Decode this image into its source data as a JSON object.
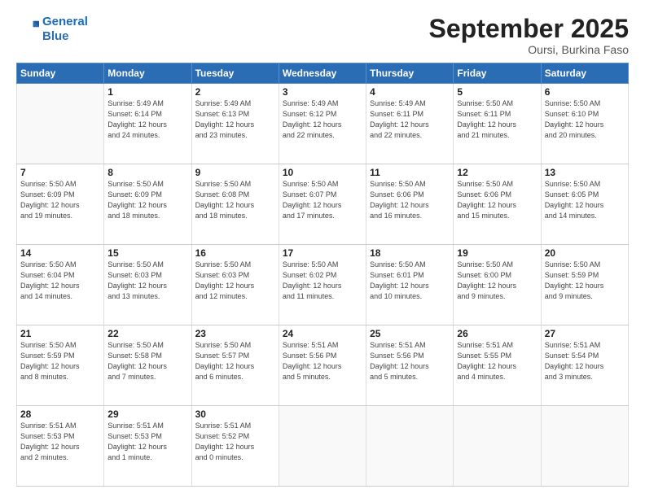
{
  "logo": {
    "line1": "General",
    "line2": "Blue"
  },
  "title": {
    "month": "September 2025",
    "location": "Oursi, Burkina Faso"
  },
  "weekdays": [
    "Sunday",
    "Monday",
    "Tuesday",
    "Wednesday",
    "Thursday",
    "Friday",
    "Saturday"
  ],
  "weeks": [
    [
      {
        "day": "",
        "info": ""
      },
      {
        "day": "1",
        "info": "Sunrise: 5:49 AM\nSunset: 6:14 PM\nDaylight: 12 hours\nand 24 minutes."
      },
      {
        "day": "2",
        "info": "Sunrise: 5:49 AM\nSunset: 6:13 PM\nDaylight: 12 hours\nand 23 minutes."
      },
      {
        "day": "3",
        "info": "Sunrise: 5:49 AM\nSunset: 6:12 PM\nDaylight: 12 hours\nand 22 minutes."
      },
      {
        "day": "4",
        "info": "Sunrise: 5:49 AM\nSunset: 6:11 PM\nDaylight: 12 hours\nand 22 minutes."
      },
      {
        "day": "5",
        "info": "Sunrise: 5:50 AM\nSunset: 6:11 PM\nDaylight: 12 hours\nand 21 minutes."
      },
      {
        "day": "6",
        "info": "Sunrise: 5:50 AM\nSunset: 6:10 PM\nDaylight: 12 hours\nand 20 minutes."
      }
    ],
    [
      {
        "day": "7",
        "info": "Sunrise: 5:50 AM\nSunset: 6:09 PM\nDaylight: 12 hours\nand 19 minutes."
      },
      {
        "day": "8",
        "info": "Sunrise: 5:50 AM\nSunset: 6:09 PM\nDaylight: 12 hours\nand 18 minutes."
      },
      {
        "day": "9",
        "info": "Sunrise: 5:50 AM\nSunset: 6:08 PM\nDaylight: 12 hours\nand 18 minutes."
      },
      {
        "day": "10",
        "info": "Sunrise: 5:50 AM\nSunset: 6:07 PM\nDaylight: 12 hours\nand 17 minutes."
      },
      {
        "day": "11",
        "info": "Sunrise: 5:50 AM\nSunset: 6:06 PM\nDaylight: 12 hours\nand 16 minutes."
      },
      {
        "day": "12",
        "info": "Sunrise: 5:50 AM\nSunset: 6:06 PM\nDaylight: 12 hours\nand 15 minutes."
      },
      {
        "day": "13",
        "info": "Sunrise: 5:50 AM\nSunset: 6:05 PM\nDaylight: 12 hours\nand 14 minutes."
      }
    ],
    [
      {
        "day": "14",
        "info": "Sunrise: 5:50 AM\nSunset: 6:04 PM\nDaylight: 12 hours\nand 14 minutes."
      },
      {
        "day": "15",
        "info": "Sunrise: 5:50 AM\nSunset: 6:03 PM\nDaylight: 12 hours\nand 13 minutes."
      },
      {
        "day": "16",
        "info": "Sunrise: 5:50 AM\nSunset: 6:03 PM\nDaylight: 12 hours\nand 12 minutes."
      },
      {
        "day": "17",
        "info": "Sunrise: 5:50 AM\nSunset: 6:02 PM\nDaylight: 12 hours\nand 11 minutes."
      },
      {
        "day": "18",
        "info": "Sunrise: 5:50 AM\nSunset: 6:01 PM\nDaylight: 12 hours\nand 10 minutes."
      },
      {
        "day": "19",
        "info": "Sunrise: 5:50 AM\nSunset: 6:00 PM\nDaylight: 12 hours\nand 9 minutes."
      },
      {
        "day": "20",
        "info": "Sunrise: 5:50 AM\nSunset: 5:59 PM\nDaylight: 12 hours\nand 9 minutes."
      }
    ],
    [
      {
        "day": "21",
        "info": "Sunrise: 5:50 AM\nSunset: 5:59 PM\nDaylight: 12 hours\nand 8 minutes."
      },
      {
        "day": "22",
        "info": "Sunrise: 5:50 AM\nSunset: 5:58 PM\nDaylight: 12 hours\nand 7 minutes."
      },
      {
        "day": "23",
        "info": "Sunrise: 5:50 AM\nSunset: 5:57 PM\nDaylight: 12 hours\nand 6 minutes."
      },
      {
        "day": "24",
        "info": "Sunrise: 5:51 AM\nSunset: 5:56 PM\nDaylight: 12 hours\nand 5 minutes."
      },
      {
        "day": "25",
        "info": "Sunrise: 5:51 AM\nSunset: 5:56 PM\nDaylight: 12 hours\nand 5 minutes."
      },
      {
        "day": "26",
        "info": "Sunrise: 5:51 AM\nSunset: 5:55 PM\nDaylight: 12 hours\nand 4 minutes."
      },
      {
        "day": "27",
        "info": "Sunrise: 5:51 AM\nSunset: 5:54 PM\nDaylight: 12 hours\nand 3 minutes."
      }
    ],
    [
      {
        "day": "28",
        "info": "Sunrise: 5:51 AM\nSunset: 5:53 PM\nDaylight: 12 hours\nand 2 minutes."
      },
      {
        "day": "29",
        "info": "Sunrise: 5:51 AM\nSunset: 5:53 PM\nDaylight: 12 hours\nand 1 minute."
      },
      {
        "day": "30",
        "info": "Sunrise: 5:51 AM\nSunset: 5:52 PM\nDaylight: 12 hours\nand 0 minutes."
      },
      {
        "day": "",
        "info": ""
      },
      {
        "day": "",
        "info": ""
      },
      {
        "day": "",
        "info": ""
      },
      {
        "day": "",
        "info": ""
      }
    ]
  ]
}
